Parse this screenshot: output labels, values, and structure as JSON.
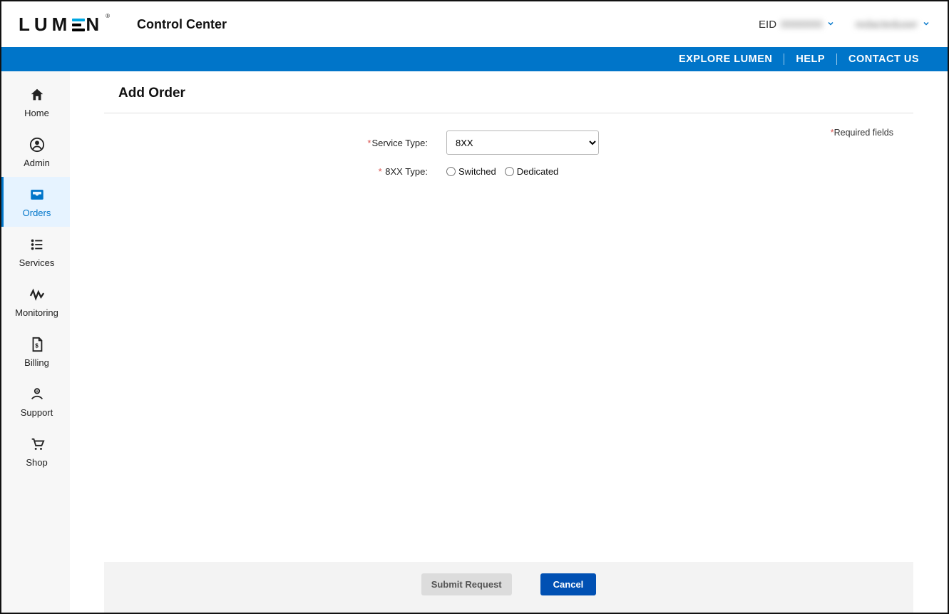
{
  "brand": {
    "wordmark_left": "LUM",
    "wordmark_right": "N",
    "registered": "®"
  },
  "appTitle": "Control Center",
  "header": {
    "eidLabel": "EID",
    "eidValue": "0000000",
    "userName": "redacteduser"
  },
  "utilityNav": {
    "explore": "EXPLORE LUMEN",
    "help": "HELP",
    "contact": "CONTACT US"
  },
  "sidebar": {
    "items": [
      {
        "label": "Home"
      },
      {
        "label": "Admin"
      },
      {
        "label": "Orders"
      },
      {
        "label": "Services"
      },
      {
        "label": "Monitoring"
      },
      {
        "label": "Billing"
      },
      {
        "label": "Support"
      },
      {
        "label": "Shop"
      }
    ],
    "activeIndex": 2
  },
  "page": {
    "title": "Add Order",
    "requiredNote": "Required fields",
    "form": {
      "serviceType": {
        "label": "Service Type:",
        "selected": "8XX",
        "options": [
          "8XX"
        ]
      },
      "subType": {
        "label": "8XX Type:",
        "options": [
          {
            "label": "Switched"
          },
          {
            "label": "Dedicated"
          }
        ]
      }
    },
    "footer": {
      "submit": "Submit Request",
      "cancel": "Cancel"
    }
  }
}
